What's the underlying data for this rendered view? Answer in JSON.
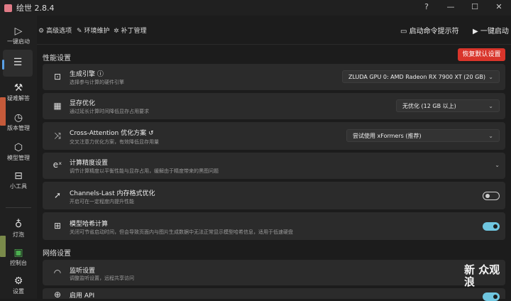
{
  "window": {
    "title": "绘世 2.8.4",
    "help": "?",
    "minimize": "—",
    "maximize": "☐",
    "close": "✕"
  },
  "sidebar": {
    "items": [
      {
        "label": "一键启动",
        "icon": "play-icon"
      },
      {
        "label": "",
        "icon": "list-icon"
      },
      {
        "label": "疑难解答",
        "icon": "tools-icon"
      },
      {
        "label": "版本管理",
        "icon": "history-icon"
      },
      {
        "label": "模型管理",
        "icon": "cube-icon"
      },
      {
        "label": "小工具",
        "icon": "toolbox-icon"
      },
      {
        "label": "灯泡",
        "icon": "bulb-icon"
      },
      {
        "label": "控制台",
        "icon": "console-icon"
      },
      {
        "label": "设置",
        "icon": "gear-icon"
      }
    ]
  },
  "tabs": [
    {
      "label": "高级选项",
      "icon": "gear-icon"
    },
    {
      "label": "环境维护",
      "icon": "wrench-icon"
    },
    {
      "label": "补丁管理",
      "icon": "patch-icon"
    }
  ],
  "toolbar": {
    "launch_cmd_label": "启动命令提示符",
    "launch_label": "一键启动"
  },
  "performance": {
    "section_title": "性能设置",
    "reset_label": "恢复默认设置",
    "items": [
      {
        "title": "生成引擎",
        "desc": "选择参与计算的硬件引擎",
        "value": "ZLUDA GPU 0: AMD Radeon RX 7900 XT (20 GB)"
      },
      {
        "title": "显存优化",
        "desc": "通过延长计算时间降低显存占用要求",
        "value": "无优化 (12 GB 以上)"
      },
      {
        "title": "Cross-Attention 优化方案",
        "desc": "交叉注意力优化方案，有效降低显存用量",
        "value": "尝试使用 xFormers (推荐)"
      },
      {
        "title": "计算精度设置",
        "desc": "调节计算精度以平衡性能与显存占用，缓解由于精度带来的黑图问题"
      },
      {
        "title": "Channels-Last 内存格式优化",
        "desc": "开启可在一定程度内提升性能",
        "toggle": "off"
      },
      {
        "title": "模型哈希计算",
        "desc": "关闭可节省启动时间，但会导致页面内与图片生成数据中无法正常显示模型哈希信息，适用于低速硬盘",
        "toggle": "on"
      }
    ]
  },
  "network": {
    "section_title": "网络设置",
    "items": [
      {
        "title": "监听设置",
        "desc": "调整监听设置，远程共享访问"
      },
      {
        "title": "启用 API",
        "desc": ""
      }
    ]
  },
  "watermark": {
    "line1": "新 众观",
    "line2": "浪"
  }
}
